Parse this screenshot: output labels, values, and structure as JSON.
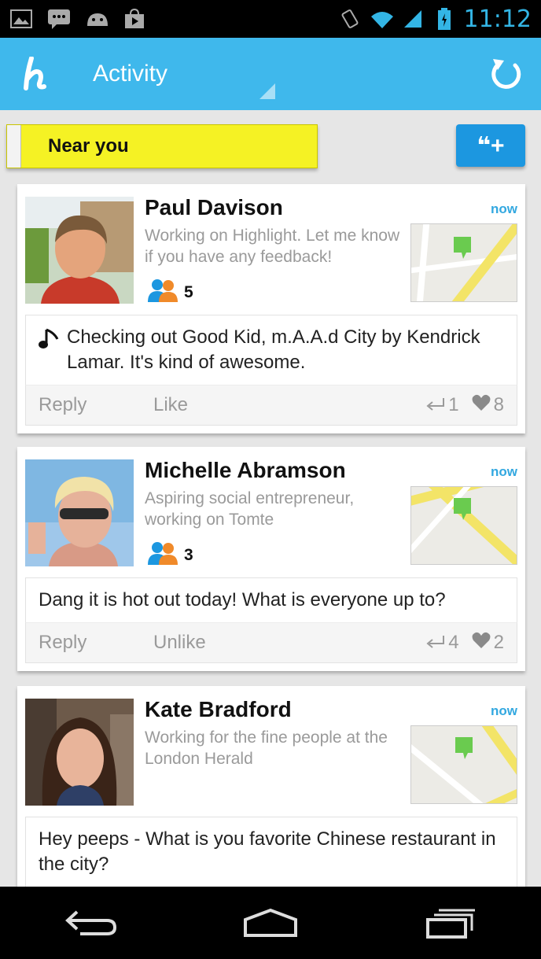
{
  "status_bar": {
    "icons_left": [
      "gallery-icon",
      "chat-icon",
      "android-icon",
      "shop-icon"
    ],
    "icons_right": [
      "vibrate-icon",
      "wifi-icon",
      "signal-icon",
      "battery-icon"
    ],
    "clock": "11:12"
  },
  "action_bar": {
    "title": "Activity",
    "logo_icon": "highlight-logo-icon",
    "refresh_icon": "refresh-icon",
    "color": "#3fb8ec"
  },
  "filter": {
    "label": "Near you",
    "compose_label": "❝+",
    "color": "#f5f224"
  },
  "cards": [
    {
      "name": "Paul Davison",
      "time": "now",
      "tagline": "Working on Highlight. Let me know if you have any feedback!",
      "friends": "5",
      "post": "Checking out Good Kid, m.A.A.d City by Kendrick Lamar. It's kind of awesome.",
      "reply_label": "Reply",
      "like_label": "Like",
      "replies": "1",
      "likes": "8"
    },
    {
      "name": "Michelle Abramson",
      "time": "now",
      "tagline": "Aspiring social entrepreneur, working on Tomte",
      "friends": "3",
      "post": "Dang it is hot out today! What is everyone up to?",
      "reply_label": "Reply",
      "like_label": "Unlike",
      "replies": "4",
      "likes": "2"
    },
    {
      "name": "Kate Bradford",
      "time": "now",
      "tagline": "Working for the fine people at the London Herald",
      "post": "Hey peeps - What is you favorite Chinese restaurant in the city?"
    }
  ],
  "nav_bar": {
    "icons": [
      "back-icon",
      "home-icon",
      "recent-apps-icon"
    ]
  }
}
